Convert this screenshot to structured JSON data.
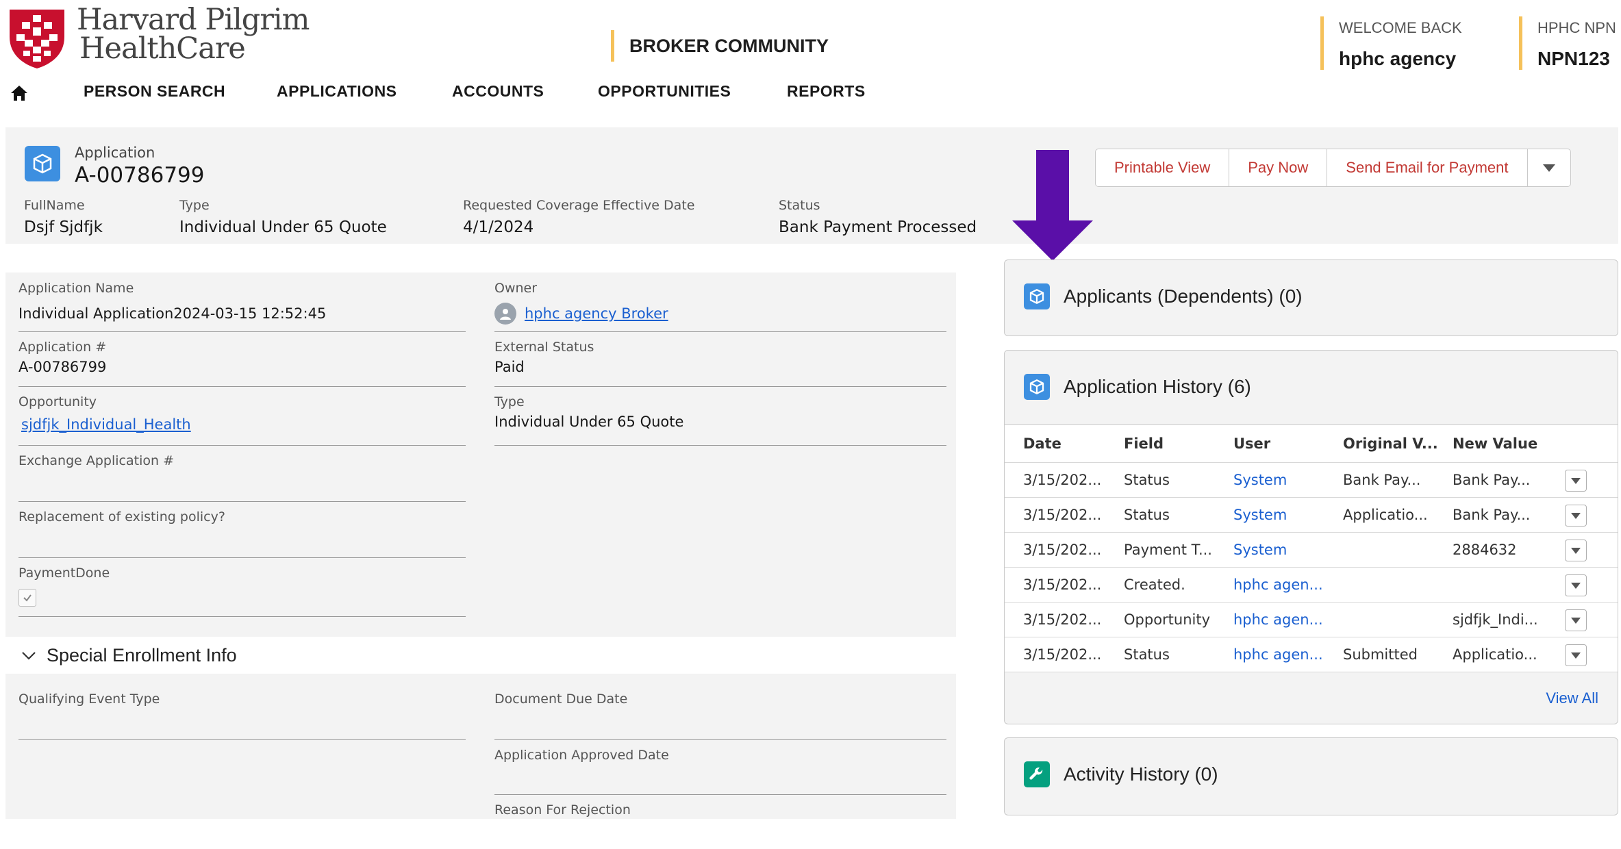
{
  "brand": {
    "line1": "Harvard Pilgrim",
    "line2": "HealthCare"
  },
  "header": {
    "community": "BROKER COMMUNITY",
    "welcome_label": "WELCOME BACK",
    "welcome_name": "hphc agency",
    "npn_label": "HPHC NPN",
    "npn_value": "NPN123"
  },
  "nav": {
    "items": [
      "PERSON SEARCH",
      "APPLICATIONS",
      "ACCOUNTS",
      "OPPORTUNITIES",
      "REPORTS"
    ]
  },
  "record": {
    "object_type": "Application",
    "id": "A-00786799",
    "fields": [
      {
        "label": "FullName",
        "value": "Dsjf Sjdfjk"
      },
      {
        "label": "Type",
        "value": "Individual Under 65 Quote"
      },
      {
        "label": "Requested Coverage Effective Date",
        "value": "4/1/2024"
      },
      {
        "label": "Status",
        "value": "Bank Payment Processed"
      }
    ],
    "actions": [
      "Printable View",
      "Pay Now",
      "Send Email for Payment"
    ]
  },
  "details": {
    "application_name": {
      "label": "Application Name",
      "value": "Individual Application2024-03-15 12:52:45"
    },
    "application_number": {
      "label": "Application #",
      "value": "A-00786799"
    },
    "opportunity": {
      "label": "Opportunity",
      "value": "sjdfjk_Individual_Health"
    },
    "exchange_application": {
      "label": "Exchange Application #",
      "value": ""
    },
    "replacement": {
      "label": "Replacement of existing policy?",
      "value": ""
    },
    "payment_done": {
      "label": "PaymentDone",
      "checked": true
    },
    "owner": {
      "label": "Owner",
      "value": "hphc agency Broker"
    },
    "external_status": {
      "label": "External Status",
      "value": "Paid"
    },
    "type": {
      "label": "Type",
      "value": "Individual Under 65 Quote"
    }
  },
  "special_enrollment": {
    "title": "Special Enrollment Info",
    "qualifying_event_type": {
      "label": "Qualifying Event Type",
      "value": ""
    },
    "document_due_date": {
      "label": "Document Due Date",
      "value": ""
    },
    "application_approved_date": {
      "label": "Application Approved Date",
      "value": ""
    },
    "reason_for_rejection": {
      "label": "Reason For Rejection",
      "value": ""
    }
  },
  "cards": {
    "applicants": {
      "title": "Applicants (Dependents) (0)"
    },
    "history": {
      "title": "Application History (6)",
      "columns": [
        "Date",
        "Field",
        "User",
        "Original V...",
        "New Value"
      ],
      "rows": [
        [
          "3/15/202...",
          "Status",
          "System",
          "Bank Pay...",
          "Bank Pay..."
        ],
        [
          "3/15/202...",
          "Status",
          "System",
          "Applicatio...",
          "Bank Pay..."
        ],
        [
          "3/15/202...",
          "Payment T...",
          "System",
          "",
          "2884632"
        ],
        [
          "3/15/202...",
          "Created.",
          "hphc agen...",
          "",
          ""
        ],
        [
          "3/15/202...",
          "Opportunity",
          "hphc agen...",
          "",
          "sjdfjk_Indi..."
        ],
        [
          "3/15/202...",
          "Status",
          "hphc agen...",
          "Submitted",
          "Applicatio..."
        ]
      ],
      "view_all": "View All"
    },
    "activity": {
      "title": "Activity History (0)"
    }
  },
  "colors": {
    "accent_gold": "#f5c15a",
    "link_blue": "#1a5fd0",
    "action_red": "#c23934",
    "arrow_purple": "#5a0fa8",
    "brand_red": "#c8102e",
    "object_icon_blue": "#3d8fe0",
    "activity_icon_teal": "#04a07f"
  },
  "icons": {
    "logo": "harvard-pilgrim-shield-logo",
    "home": "home-icon",
    "record": "cube-icon",
    "owner": "user-avatar-icon",
    "section": "chevron-down-icon",
    "activity": "wrench-icon",
    "annotation": "down-arrow-annotation"
  }
}
